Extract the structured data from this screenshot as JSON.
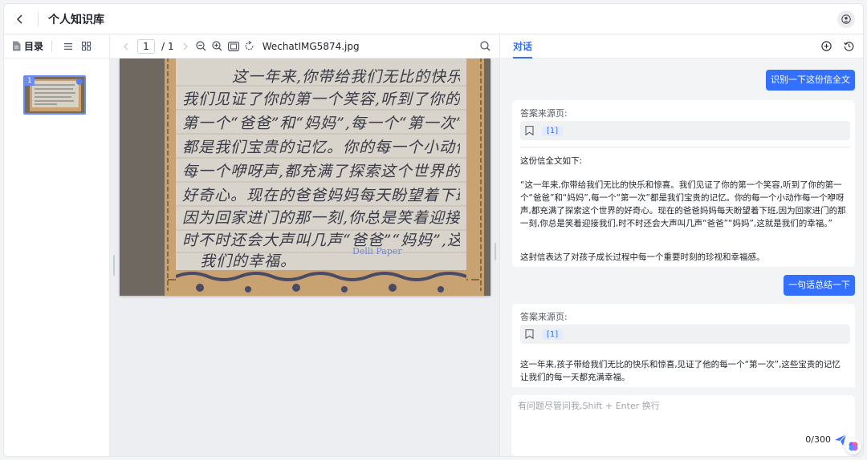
{
  "header": {
    "title": "个人知识库"
  },
  "doc_toolbar": {
    "toc_label": "目录",
    "current_page": "1",
    "total_pages": "1",
    "filename": "WechatIMG5874.jpg"
  },
  "thumbnail": {
    "page_number": "1"
  },
  "document": {
    "handwriting_lines": [
      "这一年来,你带给我们无比的快乐和惊喜",
      "我们见证了你的第一个笑容,听到了你的",
      "第一个“爸爸”和“妈妈”,每一个“第一次”",
      "都是我们宝贵的记忆。你的每一个小动作",
      "每一个咿呀声,都充满了探索这个世界的",
      "好奇心。现在的爸爸妈妈每天盼望着下班",
      "因为回家进门的那一刻,你总是笑着迎接我们",
      "时不时还会大声叫几声“爸爸”“妈妈”,这就是",
      "我们的幸福。"
    ],
    "watermark": "Delli Paper"
  },
  "chat": {
    "tab_label": "对话",
    "messages": [
      {
        "role": "user",
        "text": "识别一下这份信全文"
      },
      {
        "role": "assistant",
        "source_label": "答案来源页:",
        "source_ref": "[1]",
        "paragraphs": [
          "这份信全文如下:",
          "“这一年来,你带给我们无比的快乐和惊喜。我们见证了你的第一个笑容,听到了你的第一个“爸爸”和“妈妈”,每一个“第一次”都是我们宝贵的记忆。你的每一个小动作每一个咿呀声,都充满了探索这个世界的好奇心。现在的爸爸妈妈每天盼望着下班,因为回家进门的那一刻,你总是笑着迎接我们,时不时还会大声叫几声“爸爸”“妈妈”,这就是我们的幸福。”",
          "这封信表达了对孩子成长过程中每一个重要时刻的珍视和幸福感。"
        ]
      },
      {
        "role": "user",
        "text": "一句话总结一下"
      },
      {
        "role": "assistant",
        "source_label": "答案来源页:",
        "source_ref": "[1]",
        "paragraphs": [
          "这一年来,孩子带给我们无比的快乐和惊喜,见证了他的每一个“第一次”,这些宝贵的记忆让我们的每一天都充满幸福。"
        ]
      }
    ],
    "input": {
      "placeholder": "有问题尽管问我,Shift + Enter 换行",
      "char_count": "0/300"
    }
  },
  "colors": {
    "accent": "#3370ff",
    "paper": "#c8a270",
    "ink": "#3a3a46"
  },
  "icons": [
    "back-icon",
    "user-icon",
    "document-icon",
    "list-icon",
    "grid-icon",
    "chevron-left-icon",
    "chevron-right-icon",
    "zoom-out-icon",
    "zoom-in-icon",
    "fit-screen-icon",
    "rotate-icon",
    "search-icon",
    "bookmark-icon",
    "add-icon",
    "history-icon",
    "send-icon",
    "brain-logo-icon"
  ]
}
